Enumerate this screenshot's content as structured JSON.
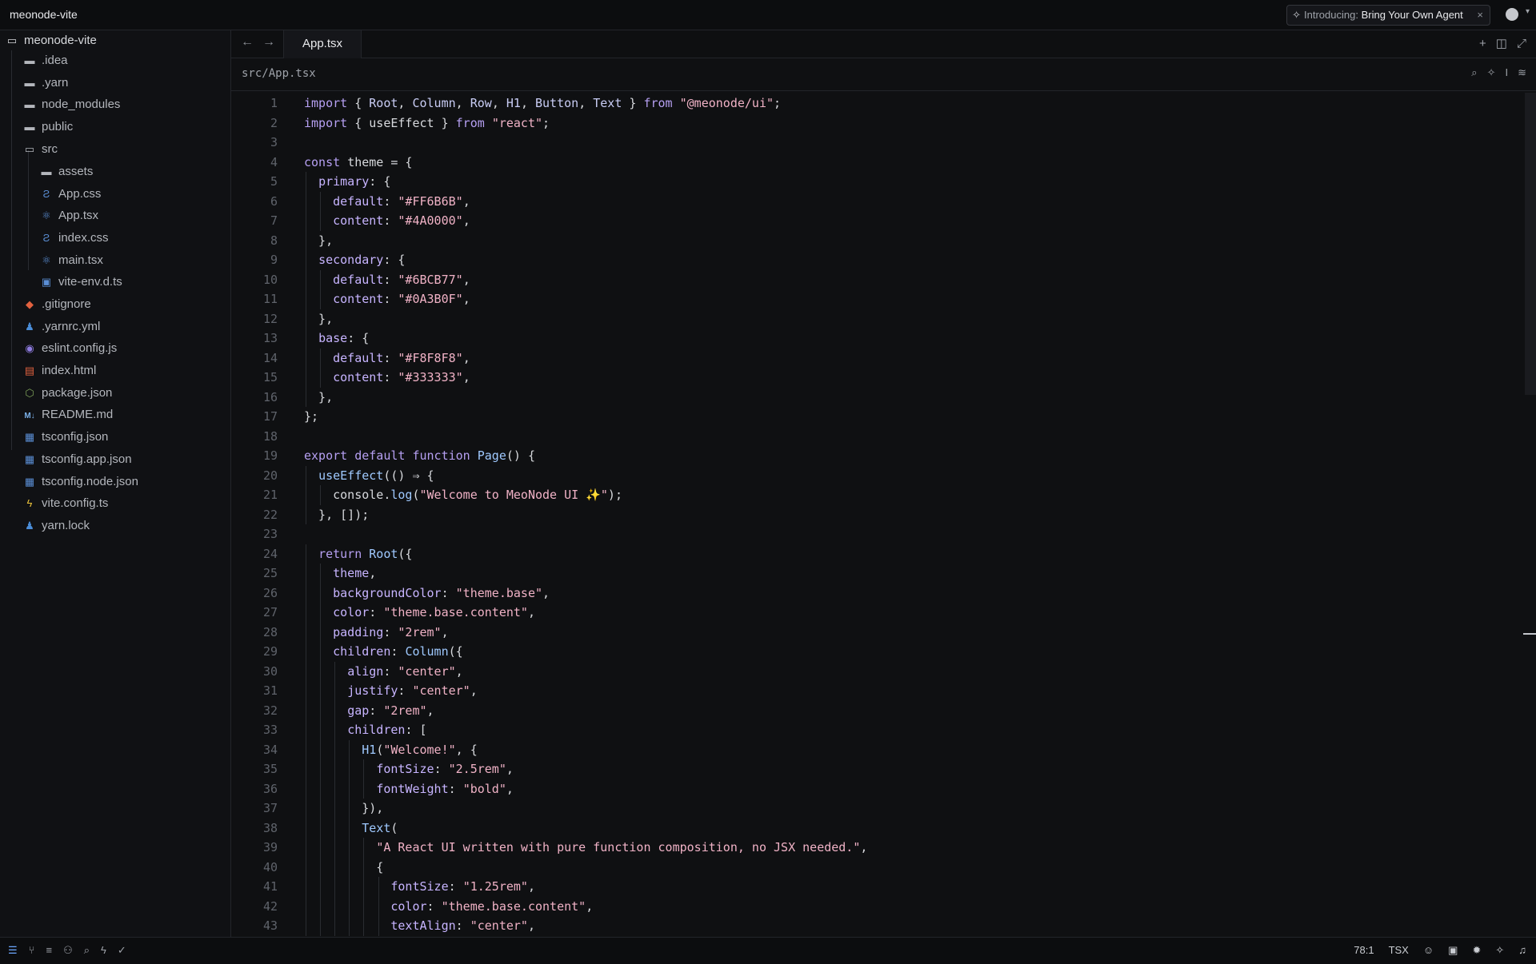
{
  "app": {
    "title": "meonode-vite"
  },
  "promo": {
    "prefix": "Introducing:",
    "text": "Bring Your Own Agent",
    "close": "×"
  },
  "sidebar": {
    "root": "meonode-vite",
    "items": [
      {
        "label": ".idea",
        "icon": "folder-icon"
      },
      {
        "label": ".yarn",
        "icon": "folder-icon"
      },
      {
        "label": "node_modules",
        "icon": "folder-icon"
      },
      {
        "label": "public",
        "icon": "folder-icon"
      },
      {
        "label": "src",
        "icon": "folder-open-icon"
      },
      {
        "label": "assets",
        "icon": "folder-icon"
      },
      {
        "label": "App.css",
        "icon": "css-icon"
      },
      {
        "label": "App.tsx",
        "icon": "react-icon"
      },
      {
        "label": "index.css",
        "icon": "css-icon"
      },
      {
        "label": "main.tsx",
        "icon": "react-icon"
      },
      {
        "label": "vite-env.d.ts",
        "icon": "typescript-icon"
      },
      {
        "label": ".gitignore",
        "icon": "git-icon"
      },
      {
        "label": ".yarnrc.yml",
        "icon": "yarn-icon"
      },
      {
        "label": "eslint.config.js",
        "icon": "eslint-icon"
      },
      {
        "label": "index.html",
        "icon": "html-icon"
      },
      {
        "label": "package.json",
        "icon": "package-icon"
      },
      {
        "label": "README.md",
        "icon": "markdown-icon"
      },
      {
        "label": "tsconfig.json",
        "icon": "tsconfig-icon"
      },
      {
        "label": "tsconfig.app.json",
        "icon": "tsconfig-icon"
      },
      {
        "label": "tsconfig.node.json",
        "icon": "tsconfig-icon"
      },
      {
        "label": "vite.config.ts",
        "icon": "vite-icon"
      },
      {
        "label": "yarn.lock",
        "icon": "yarn-icon"
      }
    ]
  },
  "editor": {
    "tab": "App.tsx",
    "breadcrumb": "src/App.tsx",
    "lines": [
      [
        {
          "t": "import ",
          "c": "kw"
        },
        {
          "t": "{ ",
          "c": "pn"
        },
        {
          "t": "Root",
          "c": "id"
        },
        {
          "t": ", ",
          "c": "pn"
        },
        {
          "t": "Column",
          "c": "id"
        },
        {
          "t": ", ",
          "c": "pn"
        },
        {
          "t": "Row",
          "c": "id"
        },
        {
          "t": ", ",
          "c": "pn"
        },
        {
          "t": "H1",
          "c": "id"
        },
        {
          "t": ", ",
          "c": "pn"
        },
        {
          "t": "Button",
          "c": "id"
        },
        {
          "t": ", ",
          "c": "pn"
        },
        {
          "t": "Text",
          "c": "id"
        },
        {
          "t": " } ",
          "c": "pn"
        },
        {
          "t": "from ",
          "c": "kw"
        },
        {
          "t": "\"@meonode/ui\"",
          "c": "st"
        },
        {
          "t": ";",
          "c": "pn"
        }
      ],
      [
        {
          "t": "import ",
          "c": "kw"
        },
        {
          "t": "{ useEffect } ",
          "c": "pn"
        },
        {
          "t": "from ",
          "c": "kw"
        },
        {
          "t": "\"react\"",
          "c": "st"
        },
        {
          "t": ";",
          "c": "pn"
        }
      ],
      [],
      [
        {
          "t": "const ",
          "c": "kw"
        },
        {
          "t": "theme = {",
          "c": "pn"
        }
      ],
      [
        {
          "t": "  "
        },
        {
          "t": "primary",
          "c": "pr"
        },
        {
          "t": ": {",
          "c": "pn"
        }
      ],
      [
        {
          "t": "    "
        },
        {
          "t": "default",
          "c": "pr"
        },
        {
          "t": ": ",
          "c": "pn"
        },
        {
          "t": "\"#FF6B6B\"",
          "c": "st"
        },
        {
          "t": ",",
          "c": "pn"
        }
      ],
      [
        {
          "t": "    "
        },
        {
          "t": "content",
          "c": "pr"
        },
        {
          "t": ": ",
          "c": "pn"
        },
        {
          "t": "\"#4A0000\"",
          "c": "st"
        },
        {
          "t": ",",
          "c": "pn"
        }
      ],
      [
        {
          "t": "  },",
          "c": "pn"
        }
      ],
      [
        {
          "t": "  "
        },
        {
          "t": "secondary",
          "c": "pr"
        },
        {
          "t": ": {",
          "c": "pn"
        }
      ],
      [
        {
          "t": "    "
        },
        {
          "t": "default",
          "c": "pr"
        },
        {
          "t": ": ",
          "c": "pn"
        },
        {
          "t": "\"#6BCB77\"",
          "c": "st"
        },
        {
          "t": ",",
          "c": "pn"
        }
      ],
      [
        {
          "t": "    "
        },
        {
          "t": "content",
          "c": "pr"
        },
        {
          "t": ": ",
          "c": "pn"
        },
        {
          "t": "\"#0A3B0F\"",
          "c": "st"
        },
        {
          "t": ",",
          "c": "pn"
        }
      ],
      [
        {
          "t": "  },",
          "c": "pn"
        }
      ],
      [
        {
          "t": "  "
        },
        {
          "t": "base",
          "c": "pr"
        },
        {
          "t": ": {",
          "c": "pn"
        }
      ],
      [
        {
          "t": "    "
        },
        {
          "t": "default",
          "c": "pr"
        },
        {
          "t": ": ",
          "c": "pn"
        },
        {
          "t": "\"#F8F8F8\"",
          "c": "st"
        },
        {
          "t": ",",
          "c": "pn"
        }
      ],
      [
        {
          "t": "    "
        },
        {
          "t": "content",
          "c": "pr"
        },
        {
          "t": ": ",
          "c": "pn"
        },
        {
          "t": "\"#333333\"",
          "c": "st"
        },
        {
          "t": ",",
          "c": "pn"
        }
      ],
      [
        {
          "t": "  },",
          "c": "pn"
        }
      ],
      [
        {
          "t": "};",
          "c": "pn"
        }
      ],
      [],
      [
        {
          "t": "export ",
          "c": "kw"
        },
        {
          "t": "default ",
          "c": "kw"
        },
        {
          "t": "function ",
          "c": "kw"
        },
        {
          "t": "Page",
          "c": "fn"
        },
        {
          "t": "() {",
          "c": "pn"
        }
      ],
      [
        {
          "t": "  "
        },
        {
          "t": "useEffect",
          "c": "fn"
        },
        {
          "t": "(() ⇒ {",
          "c": "pn"
        }
      ],
      [
        {
          "t": "    console.",
          "c": "pn"
        },
        {
          "t": "log",
          "c": "fn"
        },
        {
          "t": "(",
          "c": "pn"
        },
        {
          "t": "\"Welcome to MeoNode UI ✨\"",
          "c": "st"
        },
        {
          "t": ");",
          "c": "pn"
        }
      ],
      [
        {
          "t": "  }, []);",
          "c": "pn"
        }
      ],
      [],
      [
        {
          "t": "  "
        },
        {
          "t": "return ",
          "c": "kw"
        },
        {
          "t": "Root",
          "c": "fn"
        },
        {
          "t": "({",
          "c": "pn"
        }
      ],
      [
        {
          "t": "    "
        },
        {
          "t": "theme",
          "c": "pr"
        },
        {
          "t": ",",
          "c": "pn"
        }
      ],
      [
        {
          "t": "    "
        },
        {
          "t": "backgroundColor",
          "c": "pr"
        },
        {
          "t": ": ",
          "c": "pn"
        },
        {
          "t": "\"theme.base\"",
          "c": "st"
        },
        {
          "t": ",",
          "c": "pn"
        }
      ],
      [
        {
          "t": "    "
        },
        {
          "t": "color",
          "c": "pr"
        },
        {
          "t": ": ",
          "c": "pn"
        },
        {
          "t": "\"theme.base.content\"",
          "c": "st"
        },
        {
          "t": ",",
          "c": "pn"
        }
      ],
      [
        {
          "t": "    "
        },
        {
          "t": "padding",
          "c": "pr"
        },
        {
          "t": ": ",
          "c": "pn"
        },
        {
          "t": "\"2rem\"",
          "c": "st"
        },
        {
          "t": ",",
          "c": "pn"
        }
      ],
      [
        {
          "t": "    "
        },
        {
          "t": "children",
          "c": "pr"
        },
        {
          "t": ": ",
          "c": "pn"
        },
        {
          "t": "Column",
          "c": "fn"
        },
        {
          "t": "({",
          "c": "pn"
        }
      ],
      [
        {
          "t": "      "
        },
        {
          "t": "align",
          "c": "pr"
        },
        {
          "t": ": ",
          "c": "pn"
        },
        {
          "t": "\"center\"",
          "c": "st"
        },
        {
          "t": ",",
          "c": "pn"
        }
      ],
      [
        {
          "t": "      "
        },
        {
          "t": "justify",
          "c": "pr"
        },
        {
          "t": ": ",
          "c": "pn"
        },
        {
          "t": "\"center\"",
          "c": "st"
        },
        {
          "t": ",",
          "c": "pn"
        }
      ],
      [
        {
          "t": "      "
        },
        {
          "t": "gap",
          "c": "pr"
        },
        {
          "t": ": ",
          "c": "pn"
        },
        {
          "t": "\"2rem\"",
          "c": "st"
        },
        {
          "t": ",",
          "c": "pn"
        }
      ],
      [
        {
          "t": "      "
        },
        {
          "t": "children",
          "c": "pr"
        },
        {
          "t": ": [",
          "c": "pn"
        }
      ],
      [
        {
          "t": "        "
        },
        {
          "t": "H1",
          "c": "fn"
        },
        {
          "t": "(",
          "c": "pn"
        },
        {
          "t": "\"Welcome!\"",
          "c": "st"
        },
        {
          "t": ", {",
          "c": "pn"
        }
      ],
      [
        {
          "t": "          "
        },
        {
          "t": "fontSize",
          "c": "pr"
        },
        {
          "t": ": ",
          "c": "pn"
        },
        {
          "t": "\"2.5rem\"",
          "c": "st"
        },
        {
          "t": ",",
          "c": "pn"
        }
      ],
      [
        {
          "t": "          "
        },
        {
          "t": "fontWeight",
          "c": "pr"
        },
        {
          "t": ": ",
          "c": "pn"
        },
        {
          "t": "\"bold\"",
          "c": "st"
        },
        {
          "t": ",",
          "c": "pn"
        }
      ],
      [
        {
          "t": "        }),",
          "c": "pn"
        }
      ],
      [
        {
          "t": "        "
        },
        {
          "t": "Text",
          "c": "fn"
        },
        {
          "t": "(",
          "c": "pn"
        }
      ],
      [
        {
          "t": "          "
        },
        {
          "t": "\"A React UI written with pure function composition, no JSX needed.\"",
          "c": "st"
        },
        {
          "t": ",",
          "c": "pn"
        }
      ],
      [
        {
          "t": "          {",
          "c": "pn"
        }
      ],
      [
        {
          "t": "            "
        },
        {
          "t": "fontSize",
          "c": "pr"
        },
        {
          "t": ": ",
          "c": "pn"
        },
        {
          "t": "\"1.25rem\"",
          "c": "st"
        },
        {
          "t": ",",
          "c": "pn"
        }
      ],
      [
        {
          "t": "            "
        },
        {
          "t": "color",
          "c": "pr"
        },
        {
          "t": ": ",
          "c": "pn"
        },
        {
          "t": "\"theme.base.content\"",
          "c": "st"
        },
        {
          "t": ",",
          "c": "pn"
        }
      ],
      [
        {
          "t": "            "
        },
        {
          "t": "textAlign",
          "c": "pr"
        },
        {
          "t": ": ",
          "c": "pn"
        },
        {
          "t": "\"center\"",
          "c": "st"
        },
        {
          "t": ",",
          "c": "pn"
        }
      ]
    ]
  },
  "status": {
    "cursor": "78:1",
    "language": "TSX"
  }
}
